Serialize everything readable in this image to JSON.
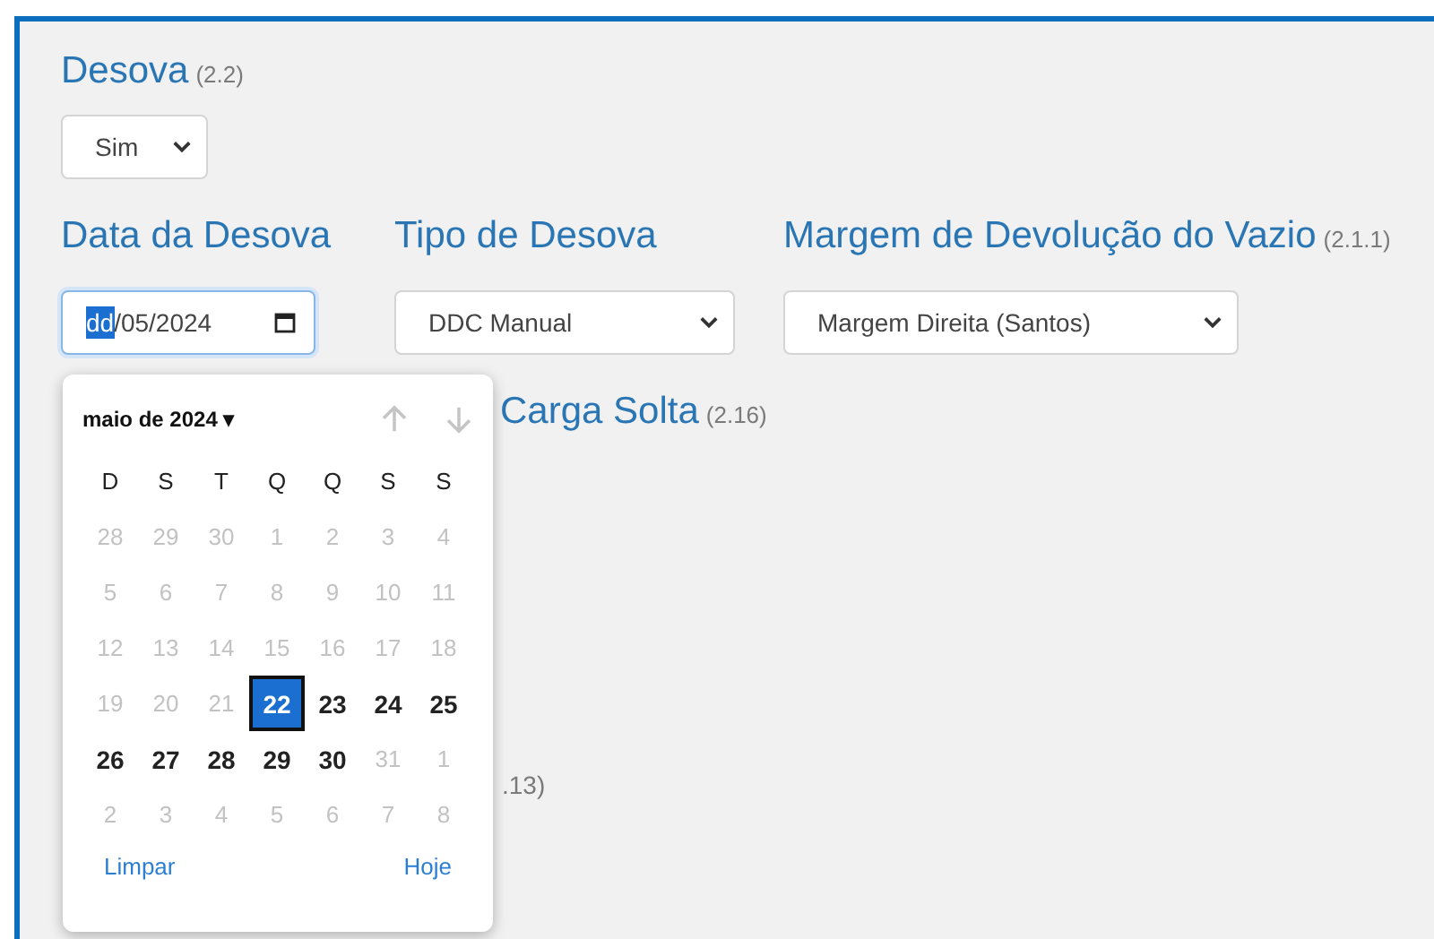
{
  "desova": {
    "label": "Desova",
    "code": "(2.2)",
    "select": {
      "value": "Sim"
    }
  },
  "fields": [
    {
      "label": "Data da Desova",
      "kind": "date",
      "segments": [
        {
          "text": "dd",
          "selected": true
        },
        {
          "text": "/05/2024",
          "selected": false
        }
      ]
    },
    {
      "label": "Tipo de Desova",
      "kind": "select",
      "value": "DDC Manual"
    },
    {
      "label": "Margem de Devolução do Vazio",
      "code": "(2.1.1)",
      "kind": "select",
      "value": "Margem Direita (Santos)"
    }
  ],
  "carga_solta": {
    "label": "Carga Solta",
    "code": "(2.16)"
  },
  "partial_code": ".13)",
  "calendar": {
    "month": "maio de 2024",
    "caret": "▾",
    "weekdays": [
      "D",
      "S",
      "T",
      "Q",
      "Q",
      "S",
      "S"
    ],
    "weeks": [
      [
        {
          "day": "28",
          "disabled": true,
          "selected": false
        },
        {
          "day": "29",
          "disabled": true,
          "selected": false
        },
        {
          "day": "30",
          "disabled": true,
          "selected": false
        },
        {
          "day": "1",
          "disabled": true,
          "selected": false
        },
        {
          "day": "2",
          "disabled": true,
          "selected": false
        },
        {
          "day": "3",
          "disabled": true,
          "selected": false
        },
        {
          "day": "4",
          "disabled": true,
          "selected": false
        }
      ],
      [
        {
          "day": "5",
          "disabled": true,
          "selected": false
        },
        {
          "day": "6",
          "disabled": true,
          "selected": false
        },
        {
          "day": "7",
          "disabled": true,
          "selected": false
        },
        {
          "day": "8",
          "disabled": true,
          "selected": false
        },
        {
          "day": "9",
          "disabled": true,
          "selected": false
        },
        {
          "day": "10",
          "disabled": true,
          "selected": false
        },
        {
          "day": "11",
          "disabled": true,
          "selected": false
        }
      ],
      [
        {
          "day": "12",
          "disabled": true,
          "selected": false
        },
        {
          "day": "13",
          "disabled": true,
          "selected": false
        },
        {
          "day": "14",
          "disabled": true,
          "selected": false
        },
        {
          "day": "15",
          "disabled": true,
          "selected": false
        },
        {
          "day": "16",
          "disabled": true,
          "selected": false
        },
        {
          "day": "17",
          "disabled": true,
          "selected": false
        },
        {
          "day": "18",
          "disabled": true,
          "selected": false
        }
      ],
      [
        {
          "day": "19",
          "disabled": true,
          "selected": false
        },
        {
          "day": "20",
          "disabled": true,
          "selected": false
        },
        {
          "day": "21",
          "disabled": true,
          "selected": false
        },
        {
          "day": "22",
          "disabled": false,
          "selected": true
        },
        {
          "day": "23",
          "disabled": false,
          "selected": false
        },
        {
          "day": "24",
          "disabled": false,
          "selected": false
        },
        {
          "day": "25",
          "disabled": false,
          "selected": false
        }
      ],
      [
        {
          "day": "26",
          "disabled": false,
          "selected": false
        },
        {
          "day": "27",
          "disabled": false,
          "selected": false
        },
        {
          "day": "28",
          "disabled": false,
          "selected": false
        },
        {
          "day": "29",
          "disabled": false,
          "selected": false
        },
        {
          "day": "30",
          "disabled": false,
          "selected": false
        },
        {
          "day": "31",
          "disabled": true,
          "selected": false
        },
        {
          "day": "1",
          "disabled": true,
          "selected": false
        }
      ],
      [
        {
          "day": "2",
          "disabled": true,
          "selected": false
        },
        {
          "day": "3",
          "disabled": true,
          "selected": false
        },
        {
          "day": "4",
          "disabled": true,
          "selected": false
        },
        {
          "day": "5",
          "disabled": true,
          "selected": false
        },
        {
          "day": "6",
          "disabled": true,
          "selected": false
        },
        {
          "day": "7",
          "disabled": true,
          "selected": false
        },
        {
          "day": "8",
          "disabled": true,
          "selected": false
        }
      ]
    ],
    "clear": "Limpar",
    "today": "Hoje"
  }
}
